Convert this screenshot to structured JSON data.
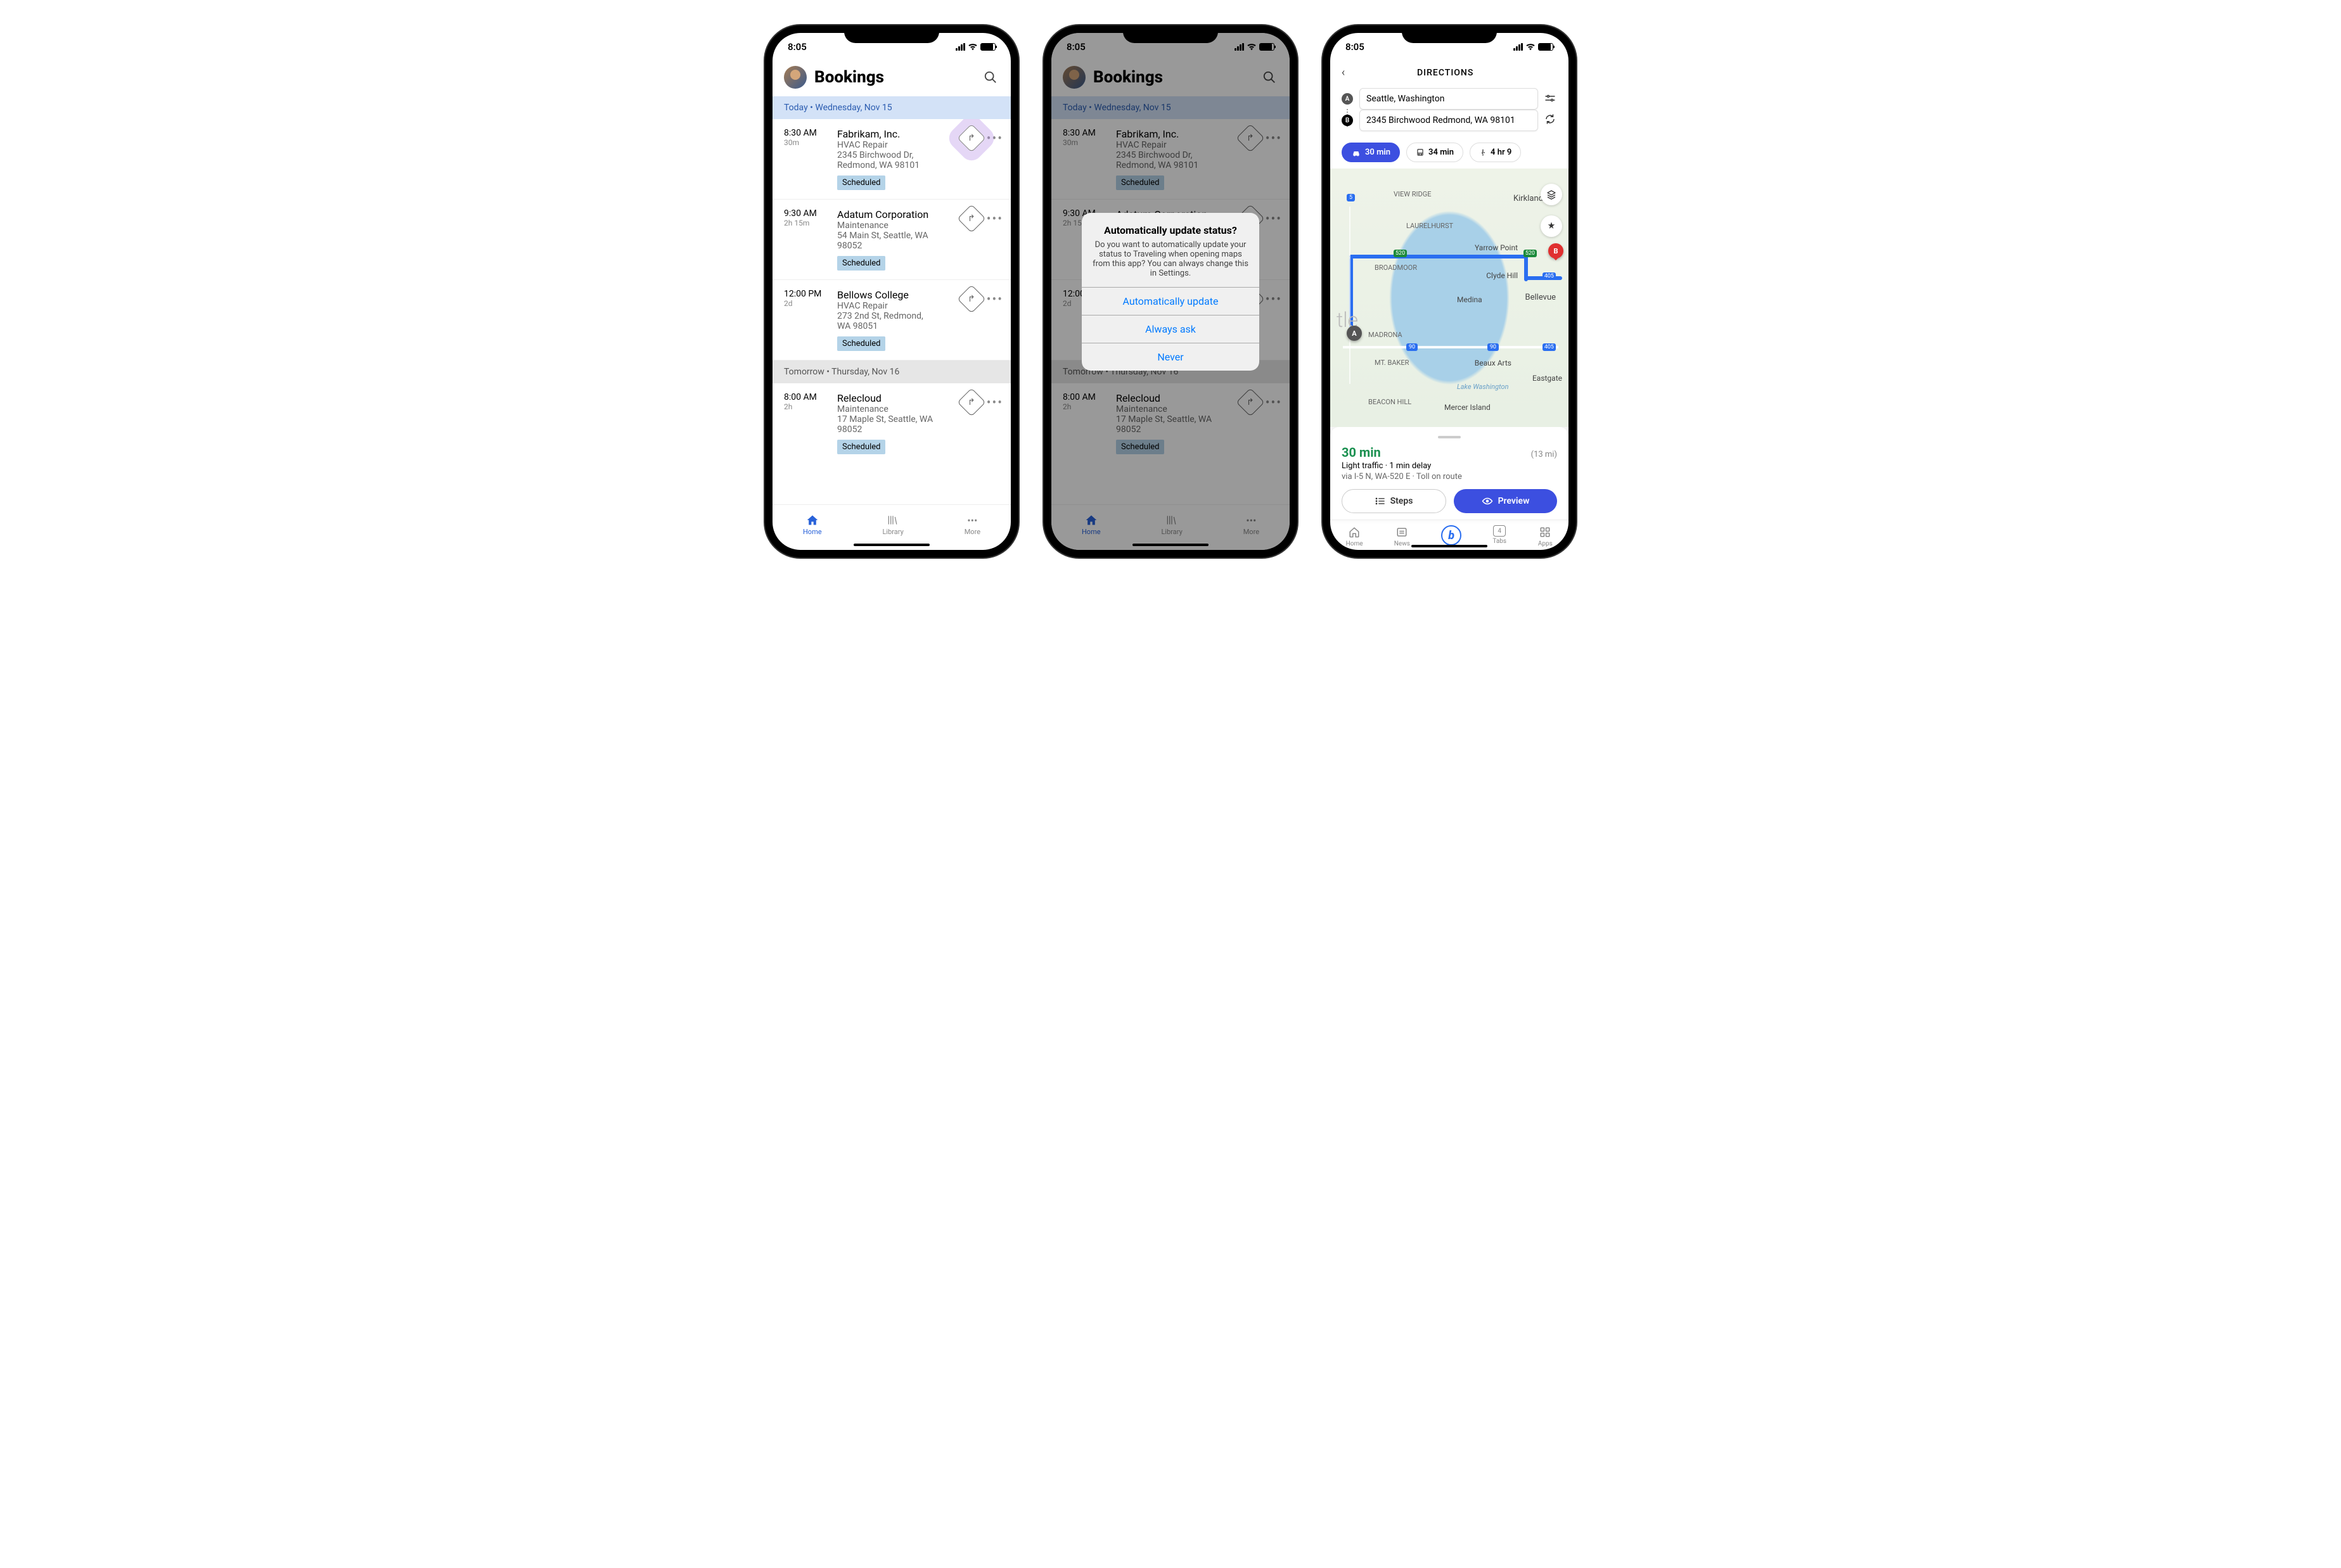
{
  "status": {
    "time": "8:05"
  },
  "bookings": {
    "title": "Bookings",
    "today_header": "Today  •  Wednesday, Nov 15",
    "tomorrow_header": "Tomorrow  •  Thursday, Nov 16",
    "items": [
      {
        "time": "8:30 AM",
        "dur": "30m",
        "title": "Fabrikam, Inc.",
        "sub": "HVAC Repair",
        "addr1": "2345 Birchwood Dr,",
        "addr2": "Redmond, WA 98101",
        "status": "Scheduled"
      },
      {
        "time": "9:30 AM",
        "dur": "2h 15m",
        "title": "Adatum Corporation",
        "sub": "Maintenance",
        "addr1": "54 Main St, Seattle, WA",
        "addr2": "98052",
        "status": "Scheduled"
      },
      {
        "time": "12:00 PM",
        "dur": "2d",
        "title": "Bellows College",
        "sub": "HVAC Repair",
        "addr1": "273 2nd St, Redmond,",
        "addr2": "WA 98051",
        "status": "Scheduled"
      },
      {
        "time": "8:00 AM",
        "dur": "2h",
        "title": "Relecloud",
        "sub": "Maintenance",
        "addr1": "17 Maple St, Seattle, WA",
        "addr2": "98052",
        "status": "Scheduled"
      }
    ],
    "tabs": {
      "home": "Home",
      "library": "Library",
      "more": "More"
    }
  },
  "alert": {
    "title": "Automatically update status?",
    "msg": "Do you want to automatically update your status to Traveling when opening maps from this app? You can always change this in Settings.",
    "auto": "Automatically update",
    "ask": "Always ask",
    "never": "Never"
  },
  "directions": {
    "title": "DIRECTIONS",
    "from": "Seattle, Washington",
    "to": "2345 Birchwood Redmond, WA 98101",
    "modes": {
      "car": "30 min",
      "transit": "34 min",
      "walk": "4 hr 9"
    },
    "result": {
      "duration": "30 min",
      "distance": "(13 mi)",
      "traffic": "Light traffic · 1 min delay",
      "via": "via I-5 N, WA-520 E · Toll on route"
    },
    "btns": {
      "steps": "Steps",
      "preview": "Preview"
    },
    "tabs": {
      "home": "Home",
      "news": "News",
      "tabs": "Tabs",
      "tabs_count": "4",
      "apps": "Apps"
    },
    "labels": {
      "viewridge": "VIEW RIDGE",
      "kirkland": "Kirkland",
      "laurelhurst": "LAURELHURST",
      "yarrow": "Yarrow Point",
      "broadmoor": "BROADMOOR",
      "clydehill": "Clyde Hill",
      "medina": "Medina",
      "bellevue": "Bellevue",
      "madrona": "MADRONA",
      "mtbaker": "MT. BAKER",
      "beaux": "Beaux Arts",
      "eastgate": "Eastgate",
      "lakewash": "Lake Washington",
      "beacon": "BEACON HILL",
      "mercer": "Mercer Island",
      "tle": "tle",
      "r5": "5",
      "r520a": "520",
      "r520b": "520",
      "r405a": "405",
      "r405b": "405",
      "r90a": "90",
      "r90b": "90"
    }
  }
}
